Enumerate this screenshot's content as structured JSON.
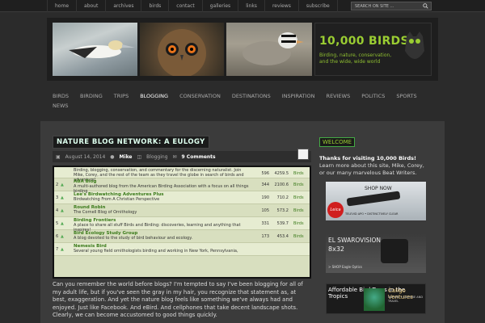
{
  "topnav": {
    "items": [
      "home",
      "about",
      "archives",
      "birds",
      "contact",
      "galleries",
      "links",
      "reviews",
      "subscribe"
    ],
    "search_placeholder": "SEARCH ON SITE ..."
  },
  "header": {
    "logo_title": "10,000 BIRDS",
    "logo_tagline": "Birding, nature, conservation, and the wide, wide world"
  },
  "mainnav": {
    "items": [
      "BIRDS",
      "BIRDING",
      "TRIPS",
      "BLOGGING",
      "CONSERVATION",
      "DESTINATIONS",
      "INSPIRATION",
      "REVIEWS",
      "POLITICS",
      "SPORTS",
      "NEWS"
    ],
    "active": "BLOGGING"
  },
  "post": {
    "title": "NATURE BLOG NETWORK: A EULOGY",
    "date": "August 14, 2014",
    "author": "Mike",
    "category": "Blogging",
    "comments": "9 Comments",
    "table": {
      "top_row": {
        "desc": "Birding, blogging, conservation, and commentary for the discerning naturalist. Join Mike, Corey, and the rest of the team as they travel the globe in search of birds and adventure!",
        "num": "596",
        "score": "4259.5",
        "cat": "Birds"
      },
      "rows": [
        {
          "rank": "2",
          "name": "ABA Blog",
          "desc": "A multi-authored blog from the American Birding Association with a focus on all things birding",
          "num": "344",
          "score": "2100.6",
          "cat": "Birds"
        },
        {
          "rank": "3",
          "name": "Lee's Birdwatching Adventures Plus",
          "desc": "Birdwatching From A Christian Perspective",
          "num": "190",
          "score": "710.2",
          "cat": "Birds"
        },
        {
          "rank": "4",
          "name": "Round Robin",
          "desc": "The Cornell Blog of Ornithology",
          "num": "105",
          "score": "573.2",
          "cat": "Birds"
        },
        {
          "rank": "5",
          "name": "Birding Frontiers",
          "desc": "A place to share all stuff Birds and Birding: discoveries, learning and anything that inspires!",
          "num": "331",
          "score": "539.7",
          "cat": "Birds"
        },
        {
          "rank": "6",
          "name": "Bird Ecology Study Group",
          "desc": "A blog devoted to the study of bird behaviour and ecology.",
          "num": "173",
          "score": "453.4",
          "cat": "Birds"
        },
        {
          "rank": "7",
          "name": "Nemesis Bird",
          "desc": "Several young field ornithologists birding and working in New York, Pennsylvania,",
          "num": "",
          "score": "",
          "cat": ""
        }
      ]
    },
    "body": "Can you remember the world before blogs? I'm tempted to say I've been blogging for all of my adult life, but if you've seen the gray in my hair, you recognize that statement as, at best, exaggeration. And yet the nature blog feels like something we've always had and enjoyed. Just like Facebook. And eBird. And cellphones that take decent landscape shots. Clearly, we can become accustomed to good things quickly."
  },
  "sidebar": {
    "welcome_title": "WELCOME",
    "welcome_bold": "Thanks for visiting 10,000 Birds!",
    "welcome_text": "Learn more about this site, Mike, Corey, or our many marvelous Beat Writers.",
    "ad1_shop": "SHOP NOW",
    "ad1_brand": "Leica",
    "ad1_bar": "TELEVID APO • DISTINCTIVELY CLEAR",
    "ad2_line1": "EL SWAROVISION",
    "ad2_line2": "8x32",
    "ad2_shop": "> SHOP Eagle Optics",
    "ad3_text": "Affordable Bird Tours in the Tropics",
    "ad3_brand": "Caligo Ventures",
    "ad3_sub": "NATURE • CULTURE AND TRAVEL"
  },
  "colors": {
    "accent": "#9acd32",
    "background": "#2b2b2b"
  }
}
